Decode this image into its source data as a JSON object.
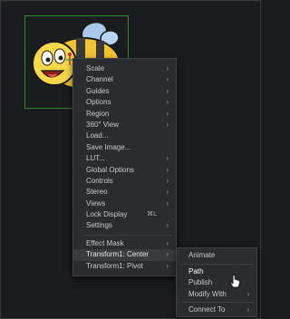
{
  "viewer": {
    "image_name": "bee-cartoon-image"
  },
  "context_menu": {
    "group1": [
      {
        "label": "Scale",
        "submenu": true
      },
      {
        "label": "Channel",
        "submenu": true
      },
      {
        "label": "Guides",
        "submenu": true
      },
      {
        "label": "Options",
        "submenu": true
      },
      {
        "label": "Region",
        "submenu": true
      },
      {
        "label": "360° View",
        "submenu": true
      },
      {
        "label": "Load...",
        "submenu": false
      },
      {
        "label": "Save Image...",
        "submenu": false
      },
      {
        "label": "LUT...",
        "submenu": true
      },
      {
        "label": "Global Options",
        "submenu": true
      },
      {
        "label": "Controls",
        "submenu": true
      },
      {
        "label": "Stereo",
        "submenu": true
      },
      {
        "label": "Views",
        "submenu": true
      },
      {
        "label": "Lock Display",
        "shortcut": "⌘L",
        "submenu": false
      },
      {
        "label": "Settings",
        "submenu": true
      }
    ],
    "group2": [
      {
        "label": "Effect Mask",
        "submenu": true
      },
      {
        "label": "Transform1: Center",
        "submenu": true,
        "highlighted": true
      },
      {
        "label": "Transform1: Pivot",
        "submenu": true
      }
    ]
  },
  "submenu": {
    "group1": [
      {
        "label": "Animate",
        "submenu": false
      }
    ],
    "group2": [
      {
        "label": "Path",
        "submenu": false,
        "hovered": true
      },
      {
        "label": "Publish",
        "submenu": false
      },
      {
        "label": "Modify With",
        "submenu": true
      }
    ],
    "group3": [
      {
        "label": "Connect To",
        "submenu": true
      }
    ]
  },
  "colors": {
    "background": "#1b1c1e",
    "menu_bg": "#2b2c2f",
    "highlight_bg": "#3a3b3f",
    "text": "#c9cacc",
    "selection_box": "#2e8a2e"
  },
  "icons": {
    "submenu_arrow": "chevron-right-icon",
    "cursor": "mouse-pointer-icon"
  }
}
